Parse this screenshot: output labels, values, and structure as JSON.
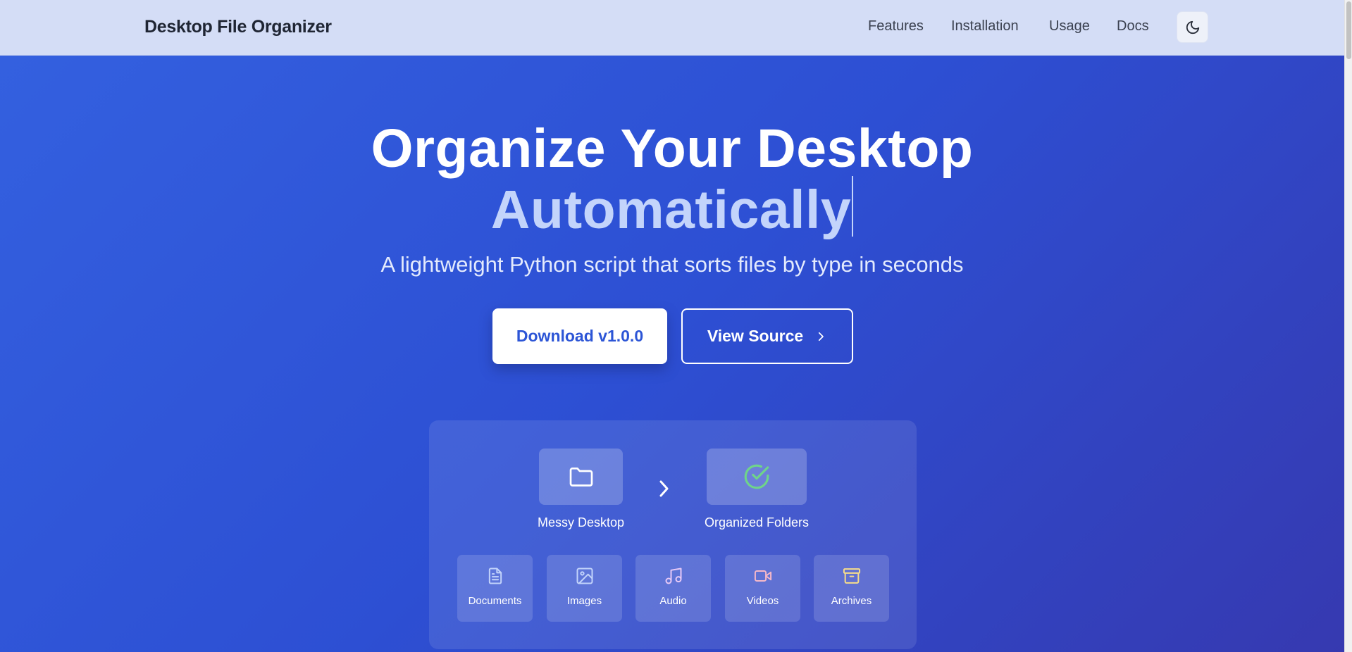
{
  "nav": {
    "brand": "Desktop File Organizer",
    "links": [
      "Features",
      "Installation",
      "Usage",
      "Docs"
    ],
    "theme_toggle_icon": "moon-icon"
  },
  "hero": {
    "title_line1": "Organize Your Desktop",
    "title_line2": "Automatically",
    "subtitle": "A lightweight Python script that sorts files by type in seconds",
    "download_label": "Download v1.0.0",
    "source_label": "View Source"
  },
  "demo": {
    "from_label": "Messy Desktop",
    "from_icon": "folder-icon",
    "to_label": "Organized Folders",
    "to_icon": "check-circle-icon",
    "categories": [
      {
        "label": "Documents",
        "icon": "document-icon",
        "color": "#c3d4fb"
      },
      {
        "label": "Images",
        "icon": "image-icon",
        "color": "#c3d4fb"
      },
      {
        "label": "Audio",
        "icon": "music-icon",
        "color": "#e7c9f7"
      },
      {
        "label": "Videos",
        "icon": "video-icon",
        "color": "#f5b8c8"
      },
      {
        "label": "Archives",
        "icon": "archive-icon",
        "color": "#f7dd8a"
      }
    ]
  },
  "colors": {
    "accent": "#2c55d6",
    "success": "#6fd48a"
  }
}
